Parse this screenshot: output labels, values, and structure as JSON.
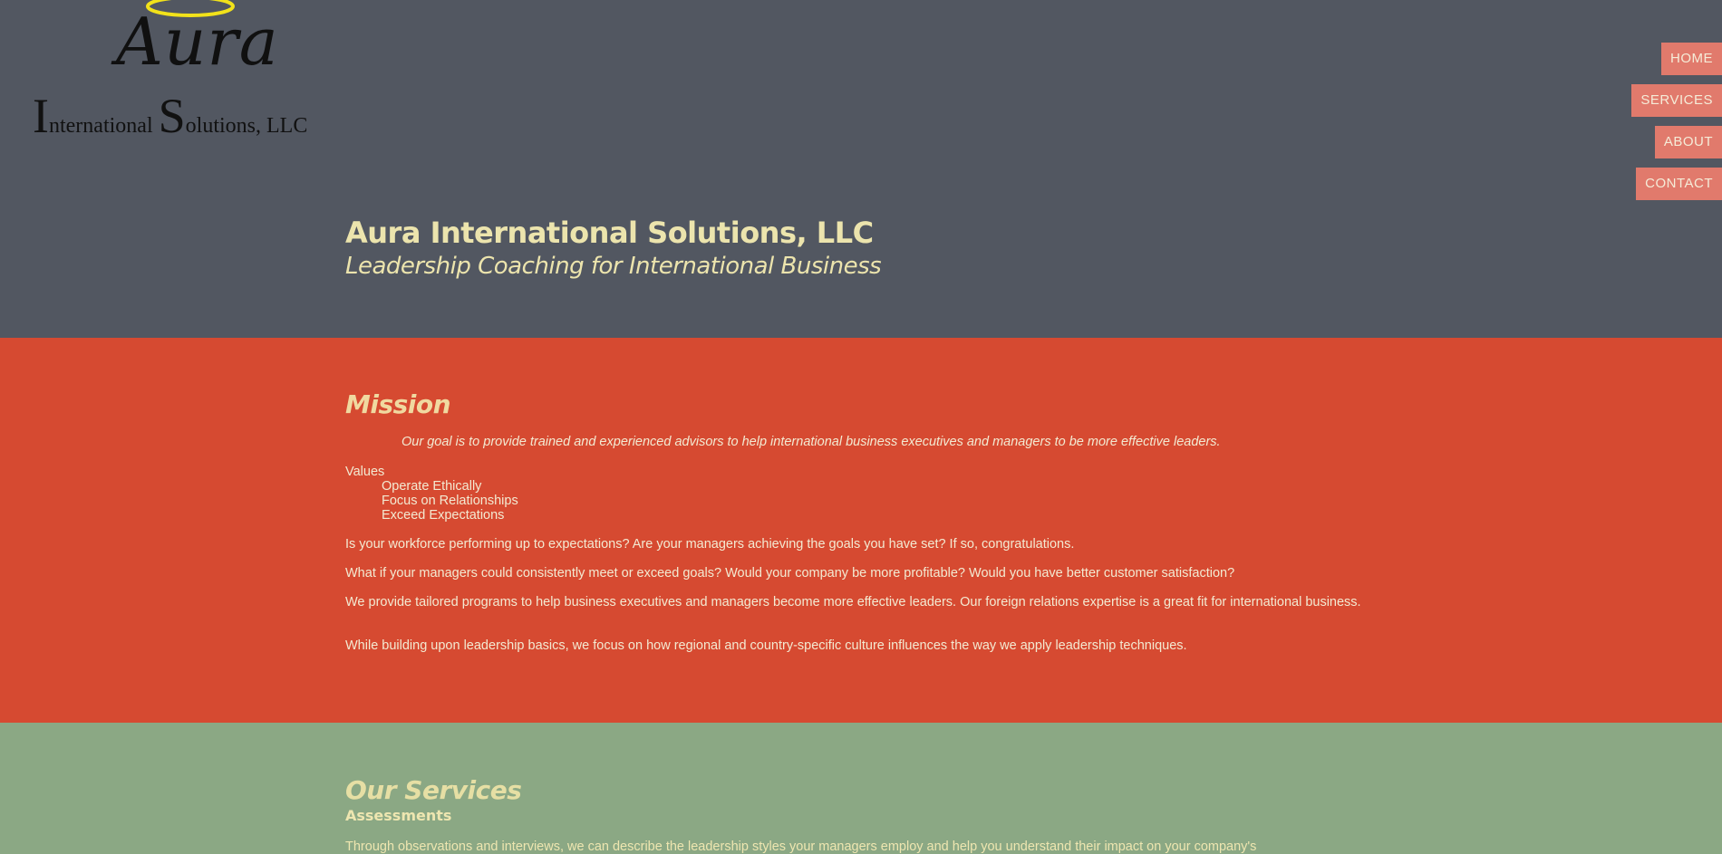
{
  "logo": {
    "word": "Aura",
    "sub_parts": [
      "I",
      "nternational ",
      "S",
      "olutions, ",
      "LLC"
    ],
    "halo_color": "#f2e21a"
  },
  "nav": {
    "items": [
      {
        "label": "HOME"
      },
      {
        "label": "SERVICES"
      },
      {
        "label": "ABOUT"
      },
      {
        "label": "CONTACT"
      }
    ]
  },
  "hero": {
    "title": "Aura International Solutions, LLC",
    "subtitle": "Leadership Coaching for International Business"
  },
  "mission": {
    "title": "Mission",
    "quote": "Our goal is to provide trained and experienced advisors to help international business executives and managers to be more effective leaders.",
    "values_label": "Values",
    "values": [
      "Operate Ethically",
      "Focus on Relationships",
      "Exceed Expectations"
    ],
    "paragraphs": [
      "Is your workforce performing up to expectations? Are your managers achieving the goals you have set? If so, congratulations.",
      "What if your managers could consistently meet or exceed goals? Would your company be more profitable? Would you have better customer satisfaction?",
      "We provide tailored programs to help business executives and managers become more effective leaders. Our foreign relations expertise is a great fit for international business.",
      "While building upon leadership basics, we focus on how regional and country-specific culture influences the way we apply leadership techniques."
    ]
  },
  "services": {
    "title": "Our Services",
    "subheading": "Assessments",
    "intro": "Through observations and interviews, we can describe the leadership styles your managers employ and help you understand their impact on your company's"
  },
  "colors": {
    "header_bg": "#525761",
    "mission_bg": "#d64a31",
    "services_bg": "#8ba884",
    "nav_bg": "#e17a6c",
    "hero_text": "#ece4ad"
  }
}
